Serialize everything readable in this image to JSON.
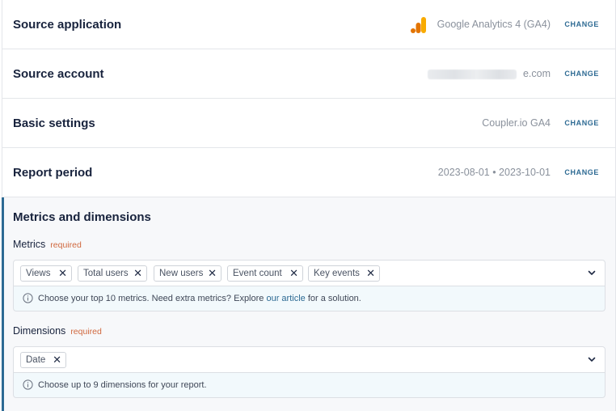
{
  "rows": [
    {
      "title": "Source application",
      "value": "Google Analytics 4 (GA4)",
      "action": "CHANGE",
      "icon": "google-analytics-icon"
    },
    {
      "title": "Source account",
      "value": "e.com",
      "action": "CHANGE"
    },
    {
      "title": "Basic settings",
      "value": "Coupler.io GA4",
      "action": "CHANGE"
    },
    {
      "title": "Report period",
      "value": "2023-08-01 • 2023-10-01",
      "action": "CHANGE"
    }
  ],
  "section": {
    "title": "Metrics and dimensions",
    "metrics": {
      "label": "Metrics",
      "required": "required",
      "chips": [
        "Views",
        "Total users",
        "New users",
        "Event count",
        "Key events"
      ],
      "hint_prefix": "Choose your top 10 metrics. Need extra metrics? Explore ",
      "hint_link": "our article",
      "hint_suffix": " for a solution."
    },
    "dimensions": {
      "label": "Dimensions",
      "required": "required",
      "chips": [
        "Date"
      ],
      "hint": "Choose up to 9 dimensions for your report."
    }
  },
  "colors": {
    "accent": "#2d6a93",
    "required": "#d0683e",
    "ga_orange": "#f9ab00",
    "ga_dark": "#e37400"
  }
}
